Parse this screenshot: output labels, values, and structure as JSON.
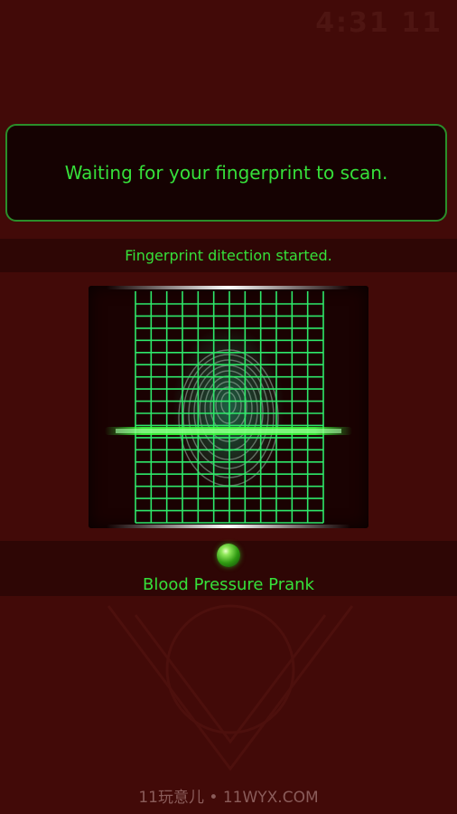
{
  "status_bar": {
    "time": "4:31 11"
  },
  "message": {
    "text": "Waiting for your fingerprint to scan."
  },
  "status": {
    "text": "Fingerprint ditection started."
  },
  "scanner": {
    "fingerprint_icon": "fingerprint-icon",
    "grid_color": "#2ee86a",
    "scan_line_color": "#3cff3c"
  },
  "indicator": {
    "icon": "green-led-icon"
  },
  "app": {
    "title": "Blood Pressure Prank"
  },
  "watermark": {
    "text": "11玩意儿 • 11WYX.COM"
  },
  "colors": {
    "background": "#420a08",
    "accent": "#36e03a",
    "box_border": "#2a8f2a"
  }
}
